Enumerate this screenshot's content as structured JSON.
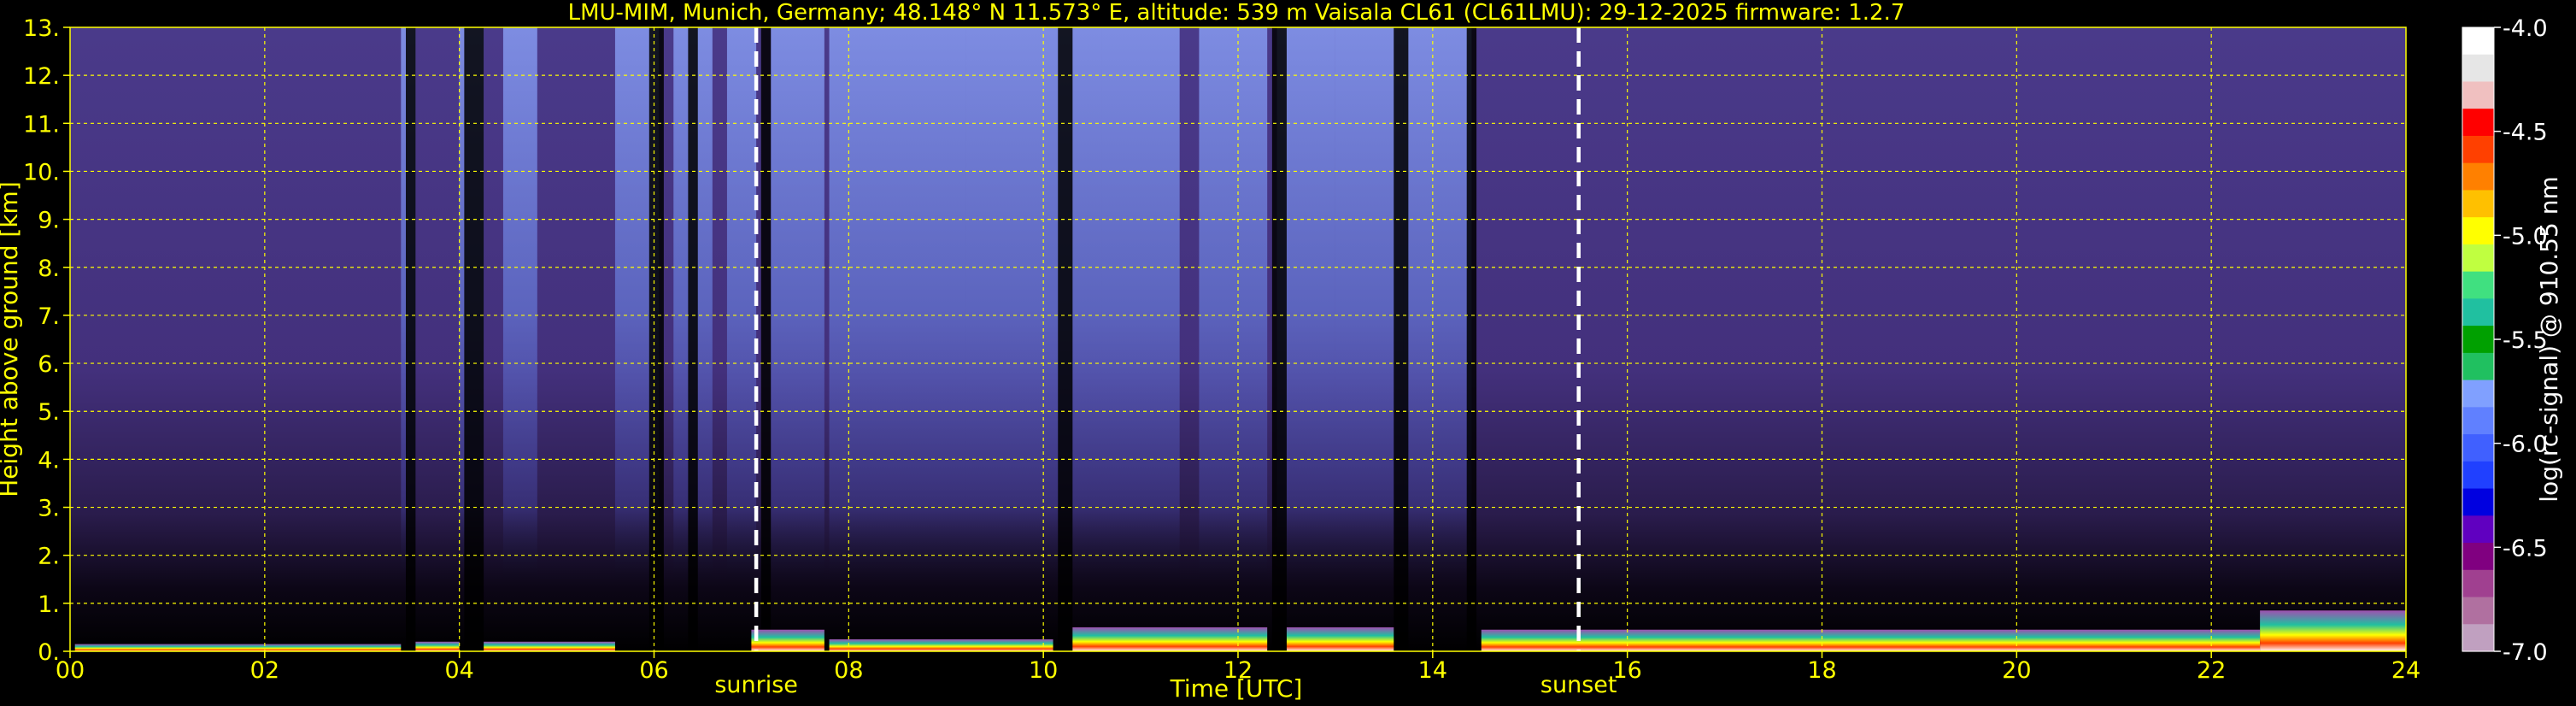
{
  "chart_data": {
    "type": "heatmap",
    "title": "LMU-MIM, Munich, Germany; 48.148° N 11.573° E, altitude: 539 m    Vaisala CL61 (CL61LMU): 29-12-2025    firmware: 1.2.7",
    "xlabel": "Time [UTC]",
    "ylabel": "Height above ground [km]",
    "xlim": [
      0,
      24
    ],
    "ylim": [
      0,
      13
    ],
    "x_ticks": [
      "00",
      "02",
      "04",
      "06",
      "08",
      "10",
      "12",
      "14",
      "16",
      "18",
      "20",
      "22",
      "24"
    ],
    "y_ticks": [
      "0.",
      "1.",
      "2.",
      "3.",
      "4.",
      "5.",
      "6.",
      "7.",
      "8.",
      "9.",
      "10.",
      "11.",
      "12.",
      "13."
    ],
    "grid": true,
    "grid_color": "#ffff00",
    "colorbar": {
      "label": "log(rc-signal) @ 910.55 nm",
      "range": [
        -7.0,
        -4.0
      ],
      "ticks": [
        "-4.0",
        "-4.5",
        "-5.0",
        "-5.5",
        "-6.0",
        "-6.5",
        "-7.0"
      ],
      "colors": [
        "#ffffff",
        "#e6e6e6",
        "#f0c0c0",
        "#ff0000",
        "#ff4000",
        "#ff8000",
        "#ffc000",
        "#ffff00",
        "#c0ff40",
        "#40e080",
        "#20c0a0",
        "#00a000",
        "#20c060",
        "#80a0ff",
        "#6080ff",
        "#4060ff",
        "#2040ff",
        "#0000e0",
        "#6000c0",
        "#800080",
        "#a04090",
        "#b070a0",
        "#c0a0c0"
      ]
    },
    "annotations": [
      {
        "label": "sunrise",
        "x": 7.05
      },
      {
        "label": "sunset",
        "x": 15.5
      }
    ],
    "bright_columns": [
      [
        3.4,
        3.55
      ],
      [
        4.0,
        4.25
      ],
      [
        4.45,
        4.8
      ],
      [
        5.6,
        6.05
      ],
      [
        6.2,
        6.6
      ],
      [
        6.75,
        7.05
      ],
      [
        7.2,
        7.75
      ],
      [
        7.8,
        9.2
      ],
      [
        9.2,
        10.6
      ],
      [
        10.6,
        11.4
      ],
      [
        11.6,
        12.3
      ],
      [
        12.4,
        13.0
      ],
      [
        13.0,
        13.7
      ],
      [
        13.7,
        14.4
      ]
    ],
    "dark_gaps": [
      [
        3.45,
        3.55
      ],
      [
        4.05,
        4.25
      ],
      [
        5.95,
        6.1
      ],
      [
        6.35,
        6.45
      ],
      [
        7.1,
        7.2
      ],
      [
        10.15,
        10.3
      ],
      [
        12.35,
        12.5
      ],
      [
        13.6,
        13.75
      ],
      [
        14.35,
        14.45
      ]
    ],
    "boundary_layer_segments": [
      {
        "x": [
          0.05,
          3.4
        ],
        "top": 0.15
      },
      {
        "x": [
          3.55,
          4.0
        ],
        "top": 0.2
      },
      {
        "x": [
          4.25,
          5.6
        ],
        "top": 0.2
      },
      {
        "x": [
          7.0,
          7.75
        ],
        "top": 0.45
      },
      {
        "x": [
          7.8,
          10.1
        ],
        "top": 0.25
      },
      {
        "x": [
          10.3,
          12.3
        ],
        "top": 0.5
      },
      {
        "x": [
          12.5,
          13.6
        ],
        "top": 0.5
      },
      {
        "x": [
          14.5,
          22.5
        ],
        "top": 0.45
      },
      {
        "x": [
          22.5,
          24.0
        ],
        "top": 0.85
      }
    ]
  }
}
